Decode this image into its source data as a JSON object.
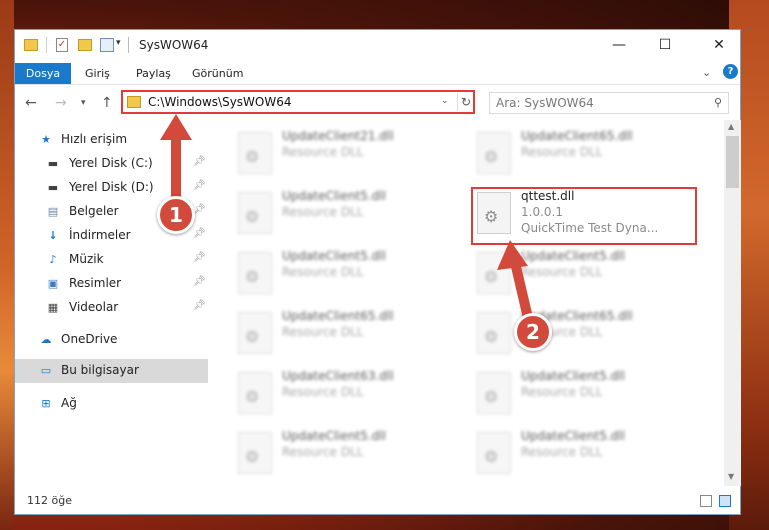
{
  "window": {
    "title": "SysWOW64",
    "controls": {
      "minimize": "—",
      "maximize": "☐",
      "close": "✕"
    }
  },
  "ribbon": {
    "tabs": [
      "Dosya",
      "Giriş",
      "Paylaş",
      "Görünüm"
    ],
    "help": "?"
  },
  "nav": {
    "address": "C:\\Windows\\SysWOW64",
    "search_placeholder": "Ara: SysWOW64"
  },
  "sidebar": {
    "items": [
      {
        "label": "Hızlı erişim",
        "icon": "star-icon",
        "pinned": false
      },
      {
        "label": "Yerel Disk (C:)",
        "icon": "drive-icon",
        "pinned": true
      },
      {
        "label": "Yerel Disk (D:)",
        "icon": "drive-icon",
        "pinned": true
      },
      {
        "label": "Belgeler",
        "icon": "documents-icon",
        "pinned": true
      },
      {
        "label": "İndirmeler",
        "icon": "download-icon",
        "pinned": true
      },
      {
        "label": "Müzik",
        "icon": "music-icon",
        "pinned": true
      },
      {
        "label": "Resimler",
        "icon": "pictures-icon",
        "pinned": true
      },
      {
        "label": "Videolar",
        "icon": "videos-icon",
        "pinned": true
      },
      {
        "label": "OneDrive",
        "icon": "cloud-icon",
        "pinned": false
      },
      {
        "label": "Bu bilgisayar",
        "icon": "computer-icon",
        "pinned": false,
        "selected": true
      },
      {
        "label": "Ağ",
        "icon": "network-icon",
        "pinned": false
      }
    ]
  },
  "files": {
    "left": [
      {
        "name": "UpdateClient21.dll",
        "desc": "Resource DLL"
      },
      {
        "name": "UpdateClient5.dll",
        "desc": "Resource DLL"
      },
      {
        "name": "UpdateClient5.dll",
        "desc": "Resource DLL"
      },
      {
        "name": "UpdateClient65.dll",
        "desc": "Resource DLL"
      },
      {
        "name": "UpdateClient63.dll",
        "desc": "Resource DLL"
      },
      {
        "name": "UpdateClient5.dll",
        "desc": "Resource DLL"
      }
    ],
    "right": [
      {
        "name": "UpdateClient65.dll",
        "desc": "Resource DLL"
      },
      {
        "name": "UpdateClient5.dll",
        "desc": "Resource DLL"
      },
      {
        "name": "UpdateClient65.dll",
        "desc": "Resource DLL"
      },
      {
        "name": "UpdateClient5.dll",
        "desc": "Resource DLL"
      },
      {
        "name": "UpdateClient5.dll",
        "desc": "Resource DLL"
      }
    ],
    "highlighted": {
      "name": "qttest.dll",
      "version": "1.0.0.1",
      "desc": "QuickTime Test Dyna..."
    }
  },
  "status": {
    "count": "112 öğe"
  },
  "annotations": {
    "badge1": "1",
    "badge2": "2",
    "color": "#d24a3c"
  }
}
